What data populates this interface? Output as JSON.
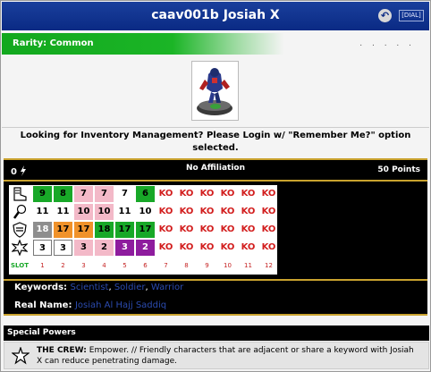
{
  "header": {
    "title": "caav001b Josiah X",
    "dial_button": "[DIAL]",
    "back_icon": "back-arrow-icon"
  },
  "rarity": {
    "label": "Rarity: Common",
    "dots": ". . . . .",
    "color": "#1bb526"
  },
  "notice": {
    "text": "Looking for Inventory Management? Please Login w/ \"Remember Me?\" option selected."
  },
  "dial": {
    "top_left": "0",
    "affiliation": "No Affiliation",
    "points": "50 Points",
    "slot_label": "SLOT",
    "stat_icons": [
      "speed-boot-icon",
      "attack-fist-icon",
      "defense-shield-icon",
      "damage-starburst-icon"
    ],
    "rows": [
      [
        {
          "v": "9",
          "c": "green"
        },
        {
          "v": "8",
          "c": "green"
        },
        {
          "v": "7",
          "c": "pink"
        },
        {
          "v": "7",
          "c": "pink"
        },
        {
          "v": "7",
          "c": "white"
        },
        {
          "v": "6",
          "c": "green"
        },
        {
          "v": "KO",
          "c": "ko"
        },
        {
          "v": "KO",
          "c": "ko"
        },
        {
          "v": "KO",
          "c": "ko"
        },
        {
          "v": "KO",
          "c": "ko"
        },
        {
          "v": "KO",
          "c": "ko"
        },
        {
          "v": "KO",
          "c": "ko"
        }
      ],
      [
        {
          "v": "11",
          "c": "white"
        },
        {
          "v": "11",
          "c": "white"
        },
        {
          "v": "10",
          "c": "pink"
        },
        {
          "v": "10",
          "c": "pink"
        },
        {
          "v": "11",
          "c": "white"
        },
        {
          "v": "10",
          "c": "white"
        },
        {
          "v": "KO",
          "c": "ko"
        },
        {
          "v": "KO",
          "c": "ko"
        },
        {
          "v": "KO",
          "c": "ko"
        },
        {
          "v": "KO",
          "c": "ko"
        },
        {
          "v": "KO",
          "c": "ko"
        },
        {
          "v": "KO",
          "c": "ko"
        }
      ],
      [
        {
          "v": "18",
          "c": "gray"
        },
        {
          "v": "17",
          "c": "orange"
        },
        {
          "v": "17",
          "c": "orange"
        },
        {
          "v": "18",
          "c": "green"
        },
        {
          "v": "17",
          "c": "green"
        },
        {
          "v": "17",
          "c": "green"
        },
        {
          "v": "KO",
          "c": "ko"
        },
        {
          "v": "KO",
          "c": "ko"
        },
        {
          "v": "KO",
          "c": "ko"
        },
        {
          "v": "KO",
          "c": "ko"
        },
        {
          "v": "KO",
          "c": "ko"
        },
        {
          "v": "KO",
          "c": "ko"
        }
      ],
      [
        {
          "v": "3",
          "c": "whiteb"
        },
        {
          "v": "3",
          "c": "whiteb"
        },
        {
          "v": "3",
          "c": "pink"
        },
        {
          "v": "2",
          "c": "pink"
        },
        {
          "v": "3",
          "c": "purple"
        },
        {
          "v": "2",
          "c": "purple"
        },
        {
          "v": "KO",
          "c": "ko"
        },
        {
          "v": "KO",
          "c": "ko"
        },
        {
          "v": "KO",
          "c": "ko"
        },
        {
          "v": "KO",
          "c": "ko"
        },
        {
          "v": "KO",
          "c": "ko"
        },
        {
          "v": "KO",
          "c": "ko"
        }
      ]
    ],
    "slots": [
      "1",
      "2",
      "3",
      "4",
      "5",
      "6",
      "7",
      "8",
      "9",
      "10",
      "11",
      "12"
    ]
  },
  "keywords": {
    "label": "Keywords:",
    "items": [
      "Scientist",
      "Soldier",
      "Warrior"
    ],
    "sep": ", "
  },
  "realname": {
    "label": "Real Name:",
    "value": "Josiah Al Hajj Saddiq"
  },
  "special": {
    "header": "Special Powers",
    "power_name": "THE CREW:",
    "power_text": " Empower. // Friendly characters that are adjacent or share a keyword with Josiah X can reduce penetrating damage.",
    "icon": "crew-star-icon"
  }
}
